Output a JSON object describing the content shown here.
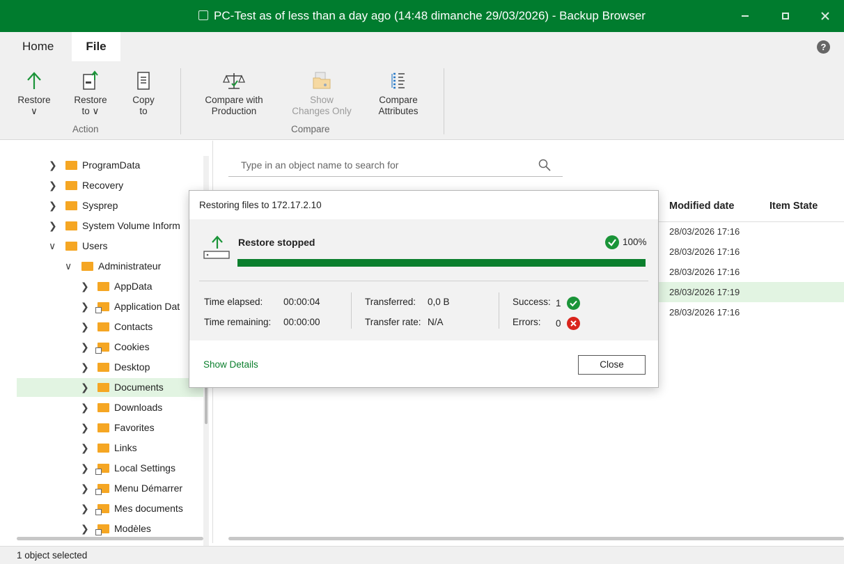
{
  "window": {
    "title": "PC-Test as of less than a day ago (14:48 dimanche 29/03/2026) - Backup Browser",
    "icon": "restore-window-icon"
  },
  "menu": {
    "tabs": [
      {
        "label": "Home"
      },
      {
        "label": "File",
        "active": true
      }
    ],
    "help": "?"
  },
  "ribbon": {
    "groups": [
      {
        "label": "Action",
        "buttons": [
          {
            "line1": "Restore",
            "line2": "∨",
            "icon": "restore-arrow-icon"
          },
          {
            "line1": "Restore",
            "line2": "to ∨",
            "icon": "restore-to-icon"
          },
          {
            "line1": "Copy",
            "line2": "to",
            "icon": "copy-to-icon"
          }
        ]
      },
      {
        "label": "Compare",
        "buttons": [
          {
            "line1": "Compare with",
            "line2": "Production",
            "icon": "scales-icon"
          },
          {
            "line1": "Show",
            "line2": "Changes Only",
            "icon": "folder-changes-icon",
            "disabled": true
          },
          {
            "line1": "Compare",
            "line2": "Attributes",
            "icon": "attributes-list-icon"
          }
        ]
      }
    ]
  },
  "tree": {
    "items": [
      {
        "label": "ProgramData",
        "chevron": "❯"
      },
      {
        "label": "Recovery",
        "chevron": "❯"
      },
      {
        "label": "Sysprep",
        "chevron": "❯"
      },
      {
        "label": "System Volume Inform",
        "chevron": "❯"
      },
      {
        "label": "Users",
        "chevron": "∨"
      },
      {
        "label": "Administrateur",
        "chevron": "∨"
      },
      {
        "label": "AppData",
        "chevron": "❯"
      },
      {
        "label": "Application Dat",
        "chevron": "❯",
        "shortcut": true
      },
      {
        "label": "Contacts",
        "chevron": "❯"
      },
      {
        "label": "Cookies",
        "chevron": "❯",
        "shortcut": true
      },
      {
        "label": "Desktop",
        "chevron": "❯"
      },
      {
        "label": "Documents",
        "chevron": "❯",
        "selected": true
      },
      {
        "label": "Downloads",
        "chevron": "❯"
      },
      {
        "label": "Favorites",
        "chevron": "❯"
      },
      {
        "label": "Links",
        "chevron": "❯"
      },
      {
        "label": "Local Settings",
        "chevron": "❯",
        "shortcut": true
      },
      {
        "label": "Menu Démarrer",
        "chevron": "❯",
        "shortcut": true
      },
      {
        "label": "Mes documents",
        "chevron": "❯",
        "shortcut": true
      },
      {
        "label": "Modèles",
        "chevron": "❯",
        "shortcut": true
      }
    ]
  },
  "search": {
    "placeholder": "Type in an object name to search for"
  },
  "table": {
    "columns": [
      "Modified date",
      "Item State"
    ],
    "rows": [
      {
        "modified": "28/03/2026 17:16"
      },
      {
        "modified": "28/03/2026 17:16"
      },
      {
        "modified": "28/03/2026 17:16"
      },
      {
        "modified": "28/03/2026 17:19",
        "selected": true
      },
      {
        "modified": "28/03/2026 17:16"
      }
    ]
  },
  "dialog": {
    "title": "Restoring files to 172.17.2.10",
    "status": "Restore stopped",
    "percent": "100%",
    "progress": 1.0,
    "stats": {
      "time_elapsed_label": "Time elapsed:",
      "time_elapsed": "00:00:04",
      "time_remaining_label": "Time remaining:",
      "time_remaining": "00:00:00",
      "transferred_label": "Transferred:",
      "transferred": "0,0 B",
      "transfer_rate_label": "Transfer rate:",
      "transfer_rate": "N/A",
      "success_label": "Success:",
      "success": "1",
      "errors_label": "Errors:",
      "errors": "0"
    },
    "show_details": "Show Details",
    "close": "Close"
  },
  "status_bar": {
    "text": "1 object selected"
  },
  "colors": {
    "accent": "#007c2e",
    "progress": "#0b7f2d",
    "success": "#1a9438",
    "error": "#d9241c",
    "selection": "#e2f4e2"
  }
}
